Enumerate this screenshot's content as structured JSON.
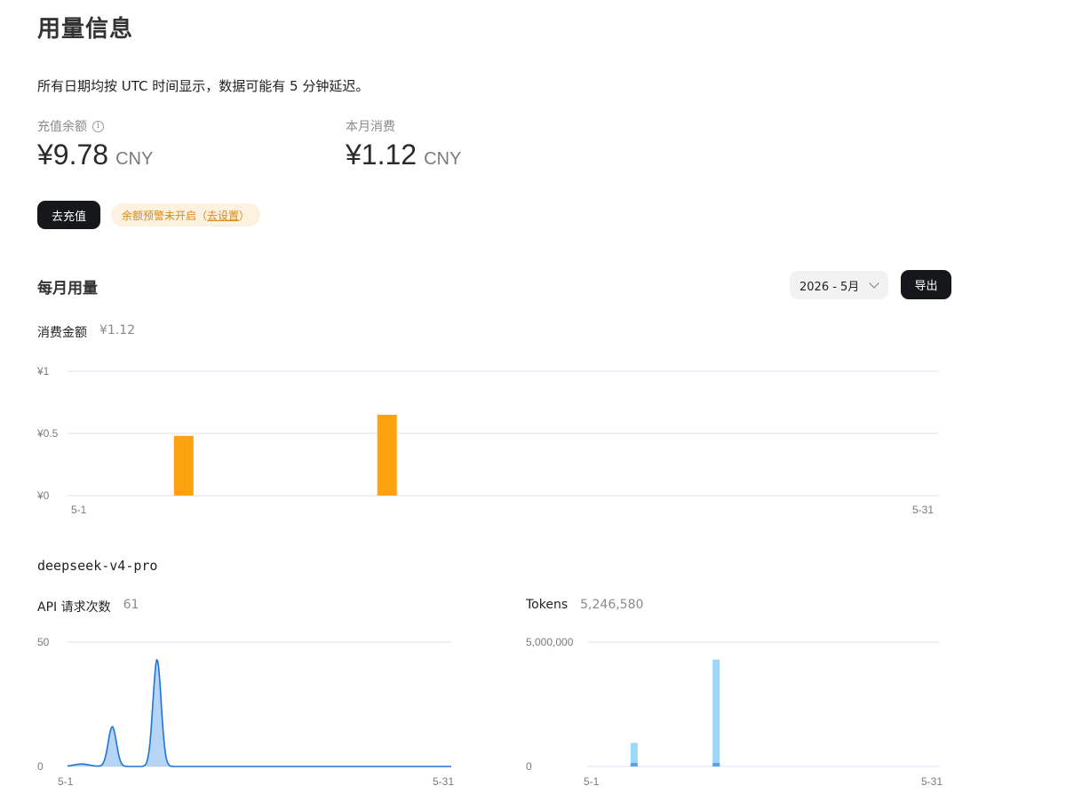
{
  "page": {
    "title": "用量信息",
    "notice": "所有日期均按 UTC 时间显示，数据可能有 5 分钟延迟。"
  },
  "balance": {
    "label": "充值余额",
    "amount": "¥9.78",
    "unit": "CNY"
  },
  "monthly_spend": {
    "label": "本月消费",
    "amount": "¥1.12",
    "unit": "CNY"
  },
  "actions": {
    "recharge_label": "去充值",
    "alert_text": "余额预警未开启（",
    "alert_link": "去设置",
    "alert_suffix": "）"
  },
  "monthly_usage": {
    "title": "每月用量",
    "month_selected": "2026 - 5月",
    "export_label": "导出"
  },
  "model": {
    "name": "deepseek-v4-pro"
  },
  "colors": {
    "cost_bar": "#ffa20f",
    "request_line": "#1f74d8",
    "request_fill": "#a9cdf4",
    "token_bar": "#9dd6fb",
    "token_bar_base": "#5aa2e6"
  },
  "chart_data": [
    {
      "id": "cost",
      "type": "bar",
      "title": "消费金额",
      "subtitle": "¥1.12",
      "x": [
        "5-5",
        "5-12"
      ],
      "x_ticks": [
        "5-1",
        "5-31"
      ],
      "xlim": [
        1,
        31
      ],
      "values": [
        0.48,
        0.65
      ],
      "y_ticks": [
        "¥0",
        "¥0.5",
        "¥1"
      ],
      "ylim": [
        0,
        1
      ],
      "grid": true
    },
    {
      "id": "requests",
      "type": "area",
      "title": "API 请求次数",
      "subtitle": "61",
      "peaks": [
        {
          "x": 2.1,
          "value": 1
        },
        {
          "x": 4.5,
          "value": 16
        },
        {
          "x": 8.0,
          "value": 43
        }
      ],
      "x_ticks": [
        "5-1",
        "5-31"
      ],
      "xlim": [
        1,
        31
      ],
      "y_ticks": [
        "0",
        "50"
      ],
      "ylim": [
        0,
        50
      ],
      "grid": true
    },
    {
      "id": "tokens",
      "type": "bar",
      "title": "Tokens",
      "subtitle": "5,246,580",
      "x": [
        "5-5",
        "5-12"
      ],
      "x_ticks": [
        "5-1",
        "5-31"
      ],
      "xlim": [
        1,
        31
      ],
      "values": [
        950000,
        4300000
      ],
      "y_ticks": [
        "0",
        "5,000,000"
      ],
      "ylim": [
        0,
        5000000
      ],
      "grid": true
    }
  ]
}
